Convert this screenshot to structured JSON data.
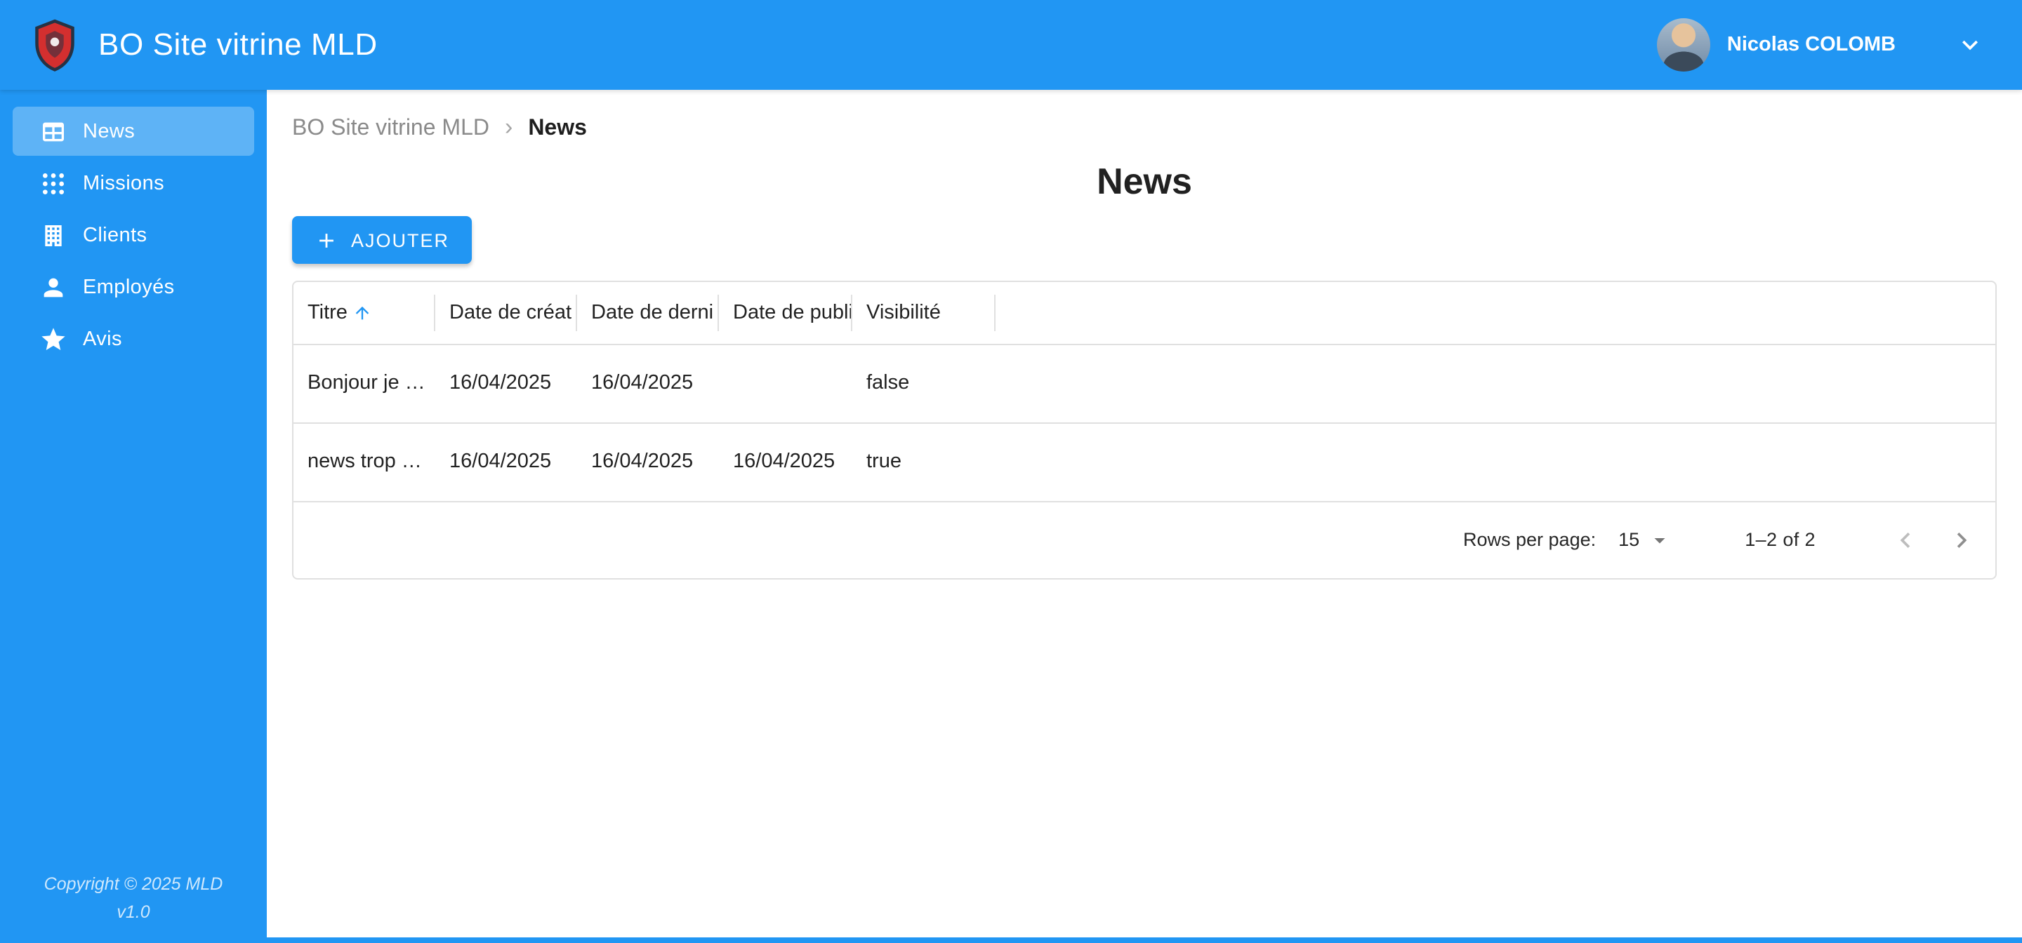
{
  "colors": {
    "primary": "#2196f3"
  },
  "app_bar": {
    "title": "BO Site vitrine MLD",
    "logo_icon": "shield-crest-logo",
    "user": {
      "name": "Nicolas COLOMB",
      "menu_icon": "chevron-down-icon"
    }
  },
  "sidebar": {
    "items": [
      {
        "label": "News",
        "icon": "table-icon",
        "active": true
      },
      {
        "label": "Missions",
        "icon": "grid-dots-icon",
        "active": false
      },
      {
        "label": "Clients",
        "icon": "office-building-icon",
        "active": false
      },
      {
        "label": "Employés",
        "icon": "person-icon",
        "active": false
      },
      {
        "label": "Avis",
        "icon": "star-icon",
        "active": false
      }
    ],
    "footer": {
      "copyright": "Copyright © 2025 MLD",
      "version": "v1.0"
    }
  },
  "breadcrumb": {
    "items": [
      "BO Site vitrine MLD",
      "News"
    ],
    "separator": "›"
  },
  "page": {
    "title": "News"
  },
  "toolbar": {
    "add_label": "AJOUTER",
    "add_icon": "plus-icon"
  },
  "table": {
    "columns": [
      "Titre",
      "Date de créat",
      "Date de derni",
      "Date de publi",
      "Visibilité"
    ],
    "sorted_column": "Titre",
    "sort_icon": "arrow-up-icon",
    "rows": [
      {
        "titre": "Bonjour je …",
        "created": "16/04/2025",
        "updated": "16/04/2025",
        "published": "",
        "visibility": "false"
      },
      {
        "titre": "news trop …",
        "created": "16/04/2025",
        "updated": "16/04/2025",
        "published": "16/04/2025",
        "visibility": "true"
      }
    ],
    "pagination": {
      "rows_per_page_label": "Rows per page:",
      "rows_per_page_value": "15",
      "range": "1–2 of 2"
    }
  }
}
